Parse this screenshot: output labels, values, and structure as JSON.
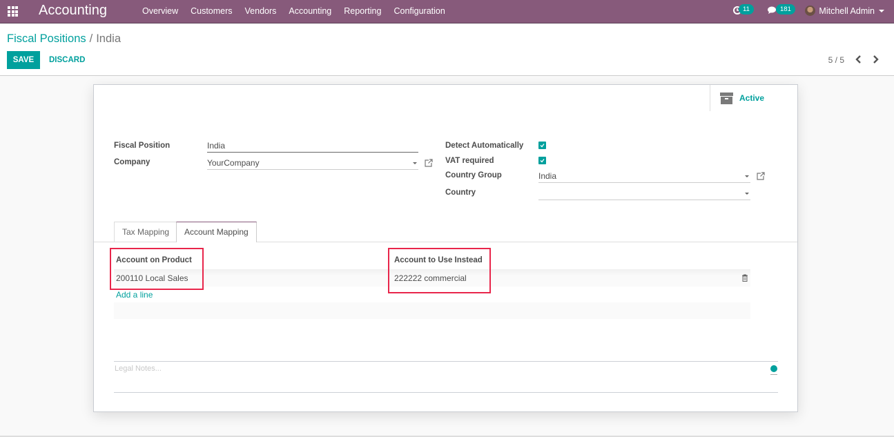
{
  "navbar": {
    "brand": "Accounting",
    "menu": [
      "Overview",
      "Customers",
      "Vendors",
      "Accounting",
      "Reporting",
      "Configuration"
    ],
    "activity_count": "11",
    "messages_count": "181",
    "user_name": "Mitchell Admin"
  },
  "control": {
    "breadcrumb_parent": "Fiscal Positions",
    "breadcrumb_separator": "/",
    "breadcrumb_current": "India",
    "save_label": "SAVE",
    "discard_label": "DISCARD",
    "pager": "5 / 5"
  },
  "form": {
    "active_label": "Active",
    "fiscal_position_label": "Fiscal Position",
    "fiscal_position_value": "India",
    "company_label": "Company",
    "company_value": "YourCompany",
    "detect_auto_label": "Detect Automatically",
    "detect_auto_checked": true,
    "vat_required_label": "VAT required",
    "vat_required_checked": true,
    "country_group_label": "Country Group",
    "country_group_value": "India",
    "country_label": "Country",
    "country_value": "",
    "tabs": [
      "Tax Mapping",
      "Account Mapping"
    ],
    "active_tab": "Account Mapping",
    "table": {
      "columns": [
        "Account on Product",
        "Account to Use Instead"
      ],
      "rows": [
        [
          "200110 Local Sales",
          "222222 commercial"
        ]
      ],
      "add_line": "Add a line"
    },
    "legal_notes_placeholder": "Legal Notes..."
  },
  "colors": {
    "navbar": "#875a7b",
    "accent": "#00a09d",
    "highlight": "#e8254a"
  }
}
